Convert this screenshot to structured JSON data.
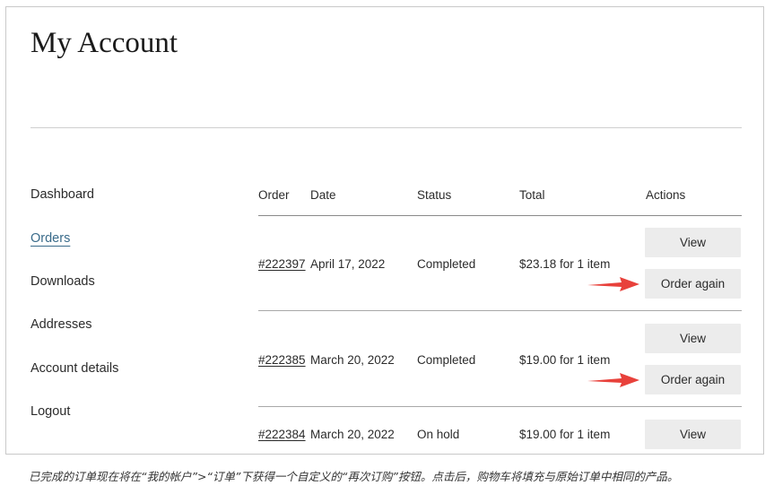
{
  "page": {
    "title": "My Account"
  },
  "nav": {
    "items": [
      {
        "label": "Dashboard",
        "active": false
      },
      {
        "label": "Orders",
        "active": true
      },
      {
        "label": "Downloads",
        "active": false
      },
      {
        "label": "Addresses",
        "active": false
      },
      {
        "label": "Account details",
        "active": false
      },
      {
        "label": "Logout",
        "active": false
      }
    ]
  },
  "orders": {
    "headers": {
      "order": "Order",
      "date": "Date",
      "status": "Status",
      "total": "Total",
      "actions": "Actions"
    },
    "rows": [
      {
        "number": "#222397",
        "date": "April 17, 2022",
        "status": "Completed",
        "total": "$23.18 for 1 item",
        "view_label": "View",
        "order_again_label": "Order again"
      },
      {
        "number": "#222385",
        "date": "March 20, 2022",
        "status": "Completed",
        "total": "$19.00 for 1 item",
        "view_label": "View",
        "order_again_label": "Order again"
      },
      {
        "number": "#222384",
        "date": "March 20, 2022",
        "status": "On hold",
        "total": "$19.00 for 1 item",
        "view_label": "View"
      }
    ]
  },
  "annotation": {
    "arrow_color": "#e8413b"
  },
  "caption": "已完成的订单现在将在“我的帐户”>“订单”下获得一个自定义的“再次订购”按钮。点击后，购物车将填充与原始订单中相同的产品。"
}
